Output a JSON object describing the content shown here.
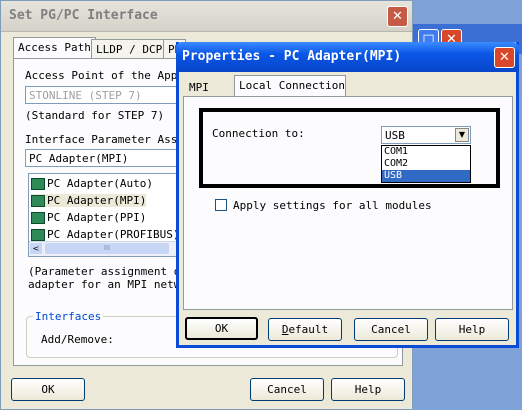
{
  "bg_window": {
    "title": "Set PG/PC Interface",
    "tabs": [
      "Access Path",
      "LLDP / DCP",
      "PN"
    ],
    "access_point_label": "Access Point of the Appli",
    "access_point_value": "STONLINE      (STEP 7)",
    "access_point_note": "(Standard for STEP 7)",
    "param_label": "Interface Parameter Assig",
    "param_value": "PC Adapter(MPI)",
    "list_items": [
      "PC Adapter(Auto)",
      "PC Adapter(MPI)",
      "PC Adapter(PPI)",
      "PC Adapter(PROFIBUS)"
    ],
    "scroll_mark": "III",
    "param_desc_line1": "(Parameter assignment of",
    "param_desc_line2": "adapter for an MPI netwo",
    "interfaces_group": "Interfaces",
    "add_remove_label": "Add/Remove:",
    "ok_label": "OK",
    "cancel_label": "Cancel",
    "help_label": "Help"
  },
  "dialog": {
    "title": "Properties - PC Adapter(MPI)",
    "tabs": [
      "MPI",
      "Local Connection"
    ],
    "connection_label": "Connection to:",
    "connection_value": "USB",
    "options": [
      "COM1",
      "COM2",
      "USB"
    ],
    "apply_label": "Apply settings for all modules",
    "ok_label": "OK",
    "default_label": "Default",
    "cancel_label": "Cancel",
    "help_label": "Help"
  },
  "colors": {
    "title_blue": "#0a56e6",
    "close_red": "#d9472b",
    "highlight": "#316ac5"
  },
  "icons": {
    "close": "close-icon",
    "dropdown": "chevron-down-icon",
    "network_adapter": "network-adapter-icon"
  }
}
